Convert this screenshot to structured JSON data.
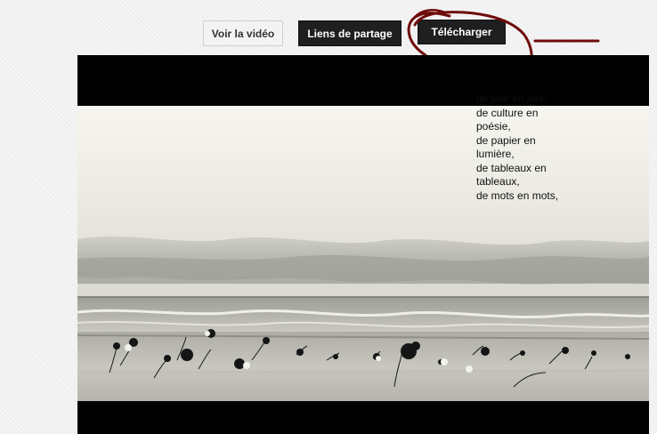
{
  "buttons": {
    "watch_video": "Voir la vidéo",
    "share_links": "Liens de partage",
    "download": "Télécharger"
  },
  "annotation_color": "#6e0b0b",
  "video": {
    "poem_lines": [
      "de jour en jour,",
      "de culture en",
      "poésie,",
      "de papier en",
      "lumière,",
      "de tableaux en",
      "tableaux,",
      "de mots en mots,"
    ]
  }
}
